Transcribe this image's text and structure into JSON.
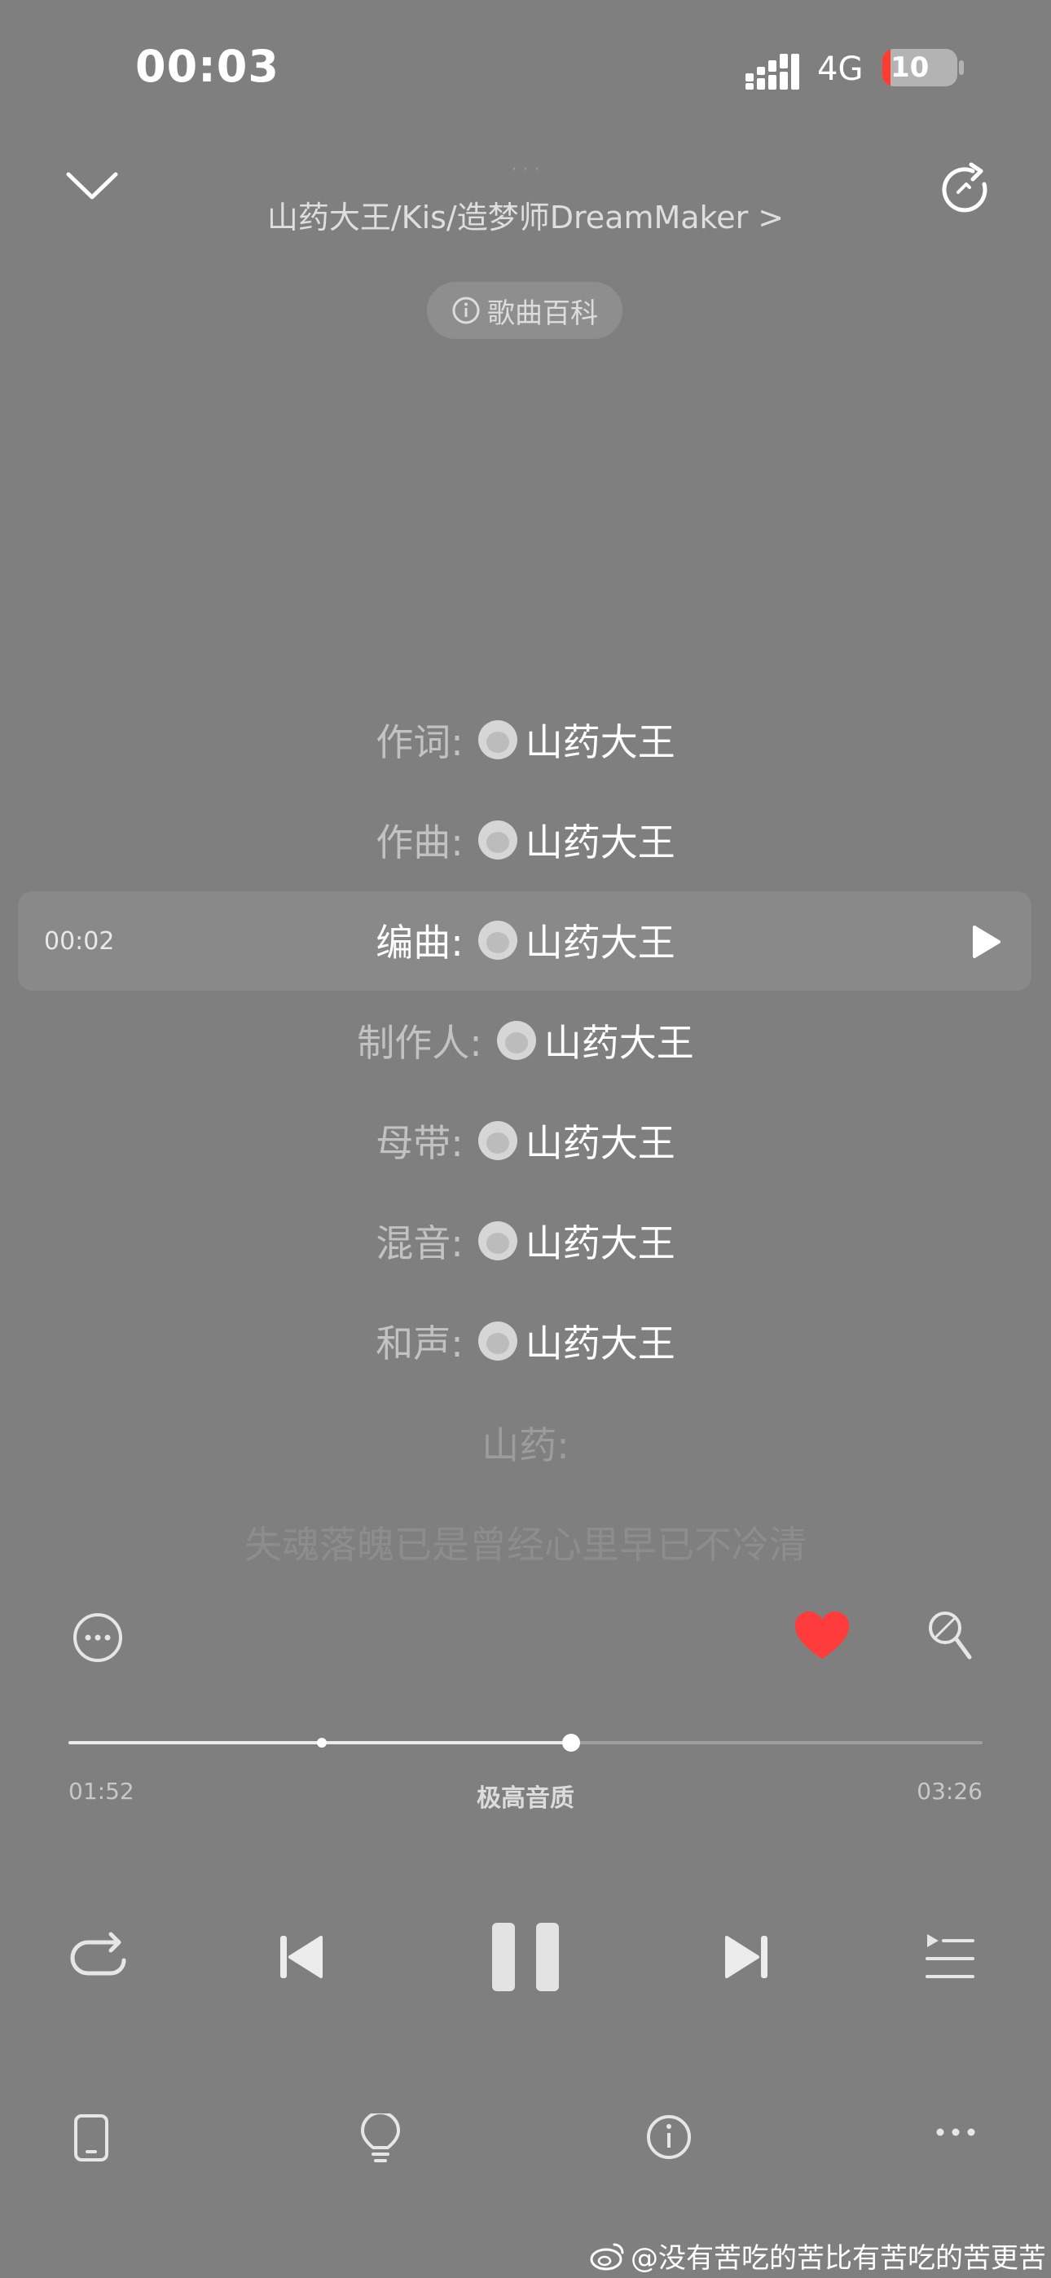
{
  "status_bar": {
    "time": "00:03",
    "network": "4G",
    "battery": "10"
  },
  "header": {
    "title_faint": "· · ·",
    "artists": "山药大王/Kis/造梦师DreamMaker >",
    "wiki_label": "歌曲百科"
  },
  "credits": [
    {
      "role": "作词:",
      "name": "山药大王"
    },
    {
      "role": "作曲:",
      "name": "山药大王"
    },
    {
      "role": "编曲:",
      "name": "山药大王"
    },
    {
      "role": "制作人:",
      "name": "山药大王"
    },
    {
      "role": "母带:",
      "name": "山药大王"
    },
    {
      "role": "混音:",
      "name": "山药大王"
    },
    {
      "role": "和声:",
      "name": "山药大王"
    }
  ],
  "current_line_time": "00:02",
  "upcoming": {
    "singer": "山药:",
    "lyric": "失魂落魄已是曾经心里早已不冷清"
  },
  "progress": {
    "current": "01:52",
    "total": "03:26",
    "quality": "极高音质",
    "played_fraction": 0.55,
    "buffered_fraction": 0.277
  },
  "icons": {
    "collapse": "chevron-down-icon",
    "refresh": "refresh-icon",
    "wiki": "info-icon",
    "more_circle": "more-circle-icon",
    "like": "heart-icon",
    "sing": "microphone-icon",
    "repeat": "repeat-icon",
    "prev": "previous-icon",
    "pause": "pause-icon",
    "next": "next-icon",
    "playlist": "playlist-icon",
    "device": "phone-device-icon",
    "bulb": "lightbulb-icon",
    "info": "info-icon",
    "more": "more-icon"
  },
  "colors": {
    "background": "#7f7f7f",
    "heart": "#ff3b3b"
  },
  "watermark": "@没有苦吃的苦比有苦吃的苦更苦"
}
